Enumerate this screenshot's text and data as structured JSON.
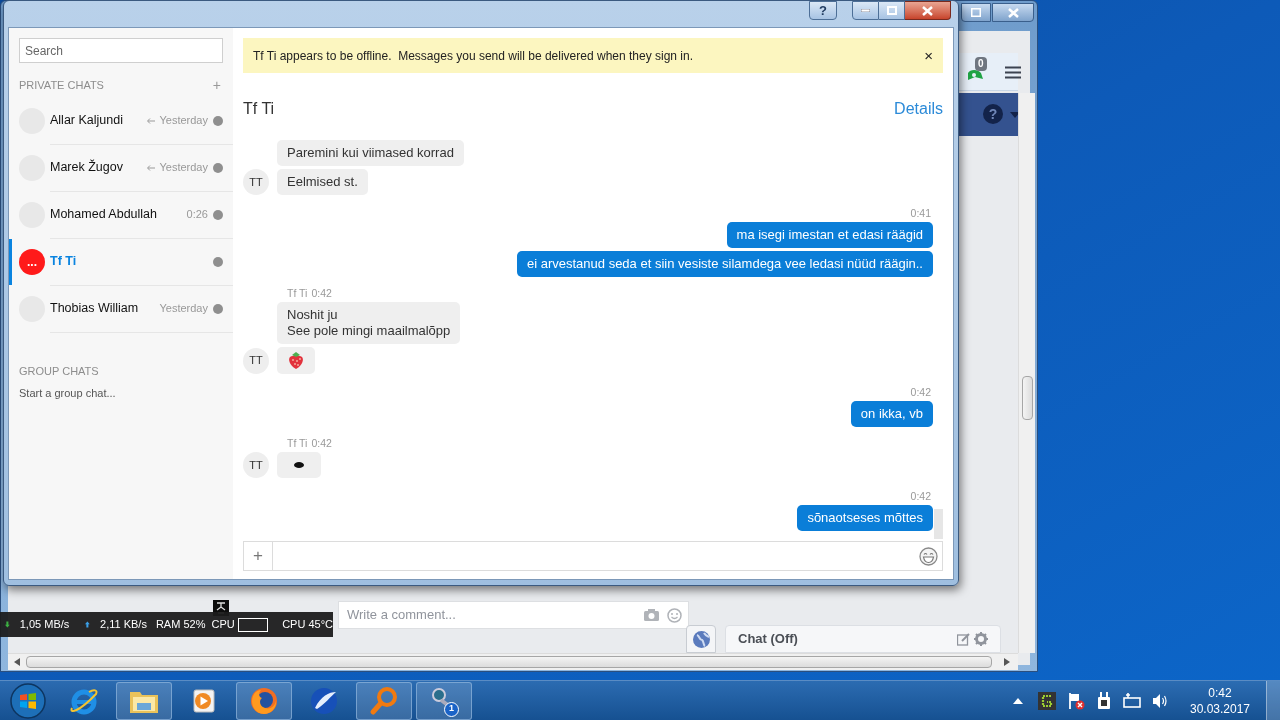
{
  "chat_window": {
    "help_button": "?"
  },
  "sidebar": {
    "search_placeholder": "Search",
    "private_header": "PRIVATE CHATS",
    "add_button": "+",
    "chats": [
      {
        "name": "Allar Kaljundi",
        "time": "Yesterday",
        "replied": true,
        "selected": false
      },
      {
        "name": "Marek Žugov",
        "time": "Yesterday",
        "replied": true,
        "selected": false
      },
      {
        "name": "Mohamed Abdullah",
        "time": "0:26",
        "replied": false,
        "selected": false
      },
      {
        "name": "Tf Ti",
        "avatar": "...",
        "replied": false,
        "selected": true
      },
      {
        "name": "Thobias William",
        "time": "Yesterday",
        "replied": false,
        "selected": false
      }
    ],
    "group_header": "GROUP CHATS",
    "group_link": "Start a group chat..."
  },
  "banner": {
    "text": "Tf Ti appears to be offline.  Messages you send will be delivered when they sign in.",
    "close": "×"
  },
  "conversation": {
    "title": "Tf Ti",
    "details": "Details",
    "messages": [
      {
        "outgoing": false,
        "kind": "text",
        "lines": [
          "Paremini kui viimased korrad"
        ]
      },
      {
        "outgoing": false,
        "kind": "text",
        "avatar": "TT",
        "lines": [
          "Eelmised st."
        ]
      },
      {
        "outgoing": true,
        "kind": "text",
        "time": "0:41",
        "lines": [
          "ma isegi imestan et edasi räägid"
        ]
      },
      {
        "outgoing": true,
        "kind": "text",
        "lines": [
          "ei arvestanud seda et siin vesiste silamdega vee ledasi nüüd räägin.."
        ]
      },
      {
        "outgoing": false,
        "kind": "text",
        "sender": "Tf Ti",
        "time": "0:42",
        "lines": [
          "Noshit ju",
          "See pole mingi maailmalõpp"
        ]
      },
      {
        "outgoing": false,
        "kind": "strawberry",
        "avatar": "TT"
      },
      {
        "outgoing": true,
        "kind": "text",
        "time": "0:42",
        "lines": [
          "on ikka, vb"
        ]
      },
      {
        "outgoing": false,
        "kind": "blob",
        "sender": "Tf Ti",
        "time": "0:42",
        "avatar": "TT"
      },
      {
        "outgoing": true,
        "kind": "text",
        "time": "0:42",
        "lines": [
          "sõnaotseses mõttes"
        ]
      }
    ],
    "composer": {
      "add_button": "+"
    }
  },
  "background_window": {
    "notification_count": "0",
    "help": "?",
    "comment_placeholder": "Write a comment...",
    "chat_bar": "Chat (Off)"
  },
  "system_monitor": {
    "download": "1,05 MB/s",
    "upload": "2,11 KB/s",
    "ram": "RAM 52%",
    "cpu_label": "CPU",
    "cpu_temp": "CPU 45°C"
  },
  "taskbar": {
    "apps": [
      {
        "kind": "ie"
      },
      {
        "kind": "folder"
      },
      {
        "kind": "media"
      },
      {
        "kind": "firefox"
      },
      {
        "kind": "feather"
      },
      {
        "kind": "magnifier"
      },
      {
        "kind": "messenger",
        "badge": "1"
      }
    ],
    "clock": {
      "time": "0:42",
      "date": "30.03.2017"
    }
  }
}
